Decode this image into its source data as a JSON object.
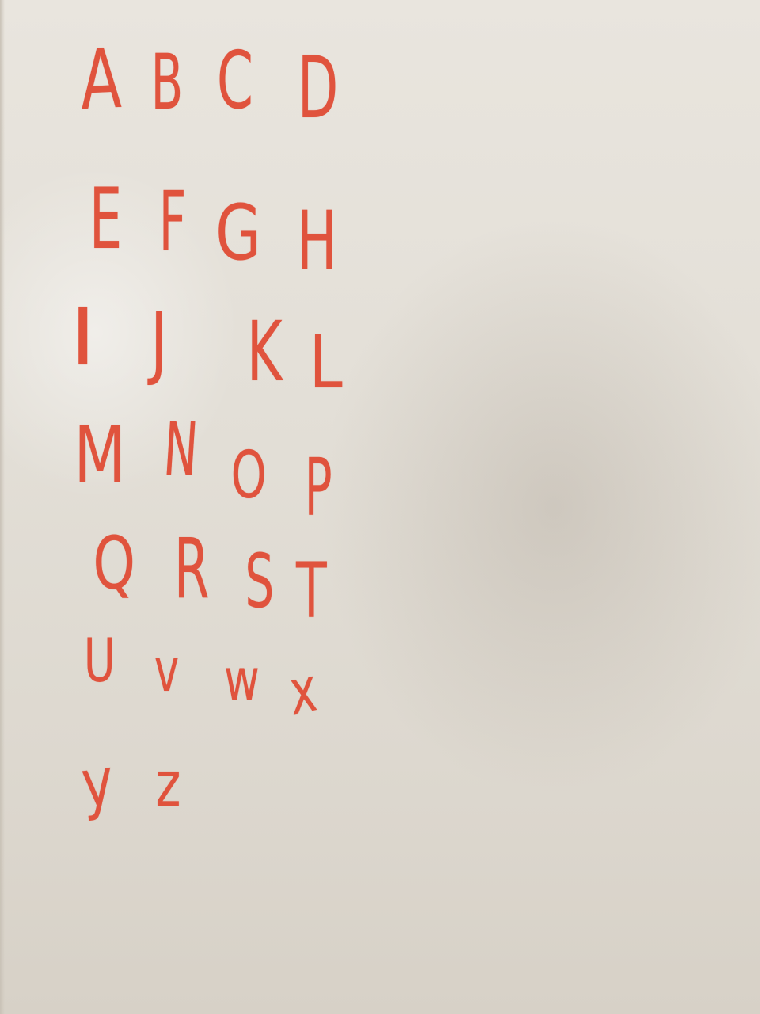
{
  "whiteboard": {
    "marker_color": "#e0533d",
    "rows": [
      [
        "A",
        "B",
        "C",
        "D"
      ],
      [
        "E",
        "F",
        "G",
        "H"
      ],
      [
        "I",
        "J",
        "K",
        "L"
      ],
      [
        "M",
        "N",
        "O",
        "P"
      ],
      [
        "Q",
        "R",
        "S",
        "T"
      ],
      [
        "U",
        "v",
        "w",
        "x"
      ],
      [
        "y",
        "z"
      ]
    ]
  }
}
